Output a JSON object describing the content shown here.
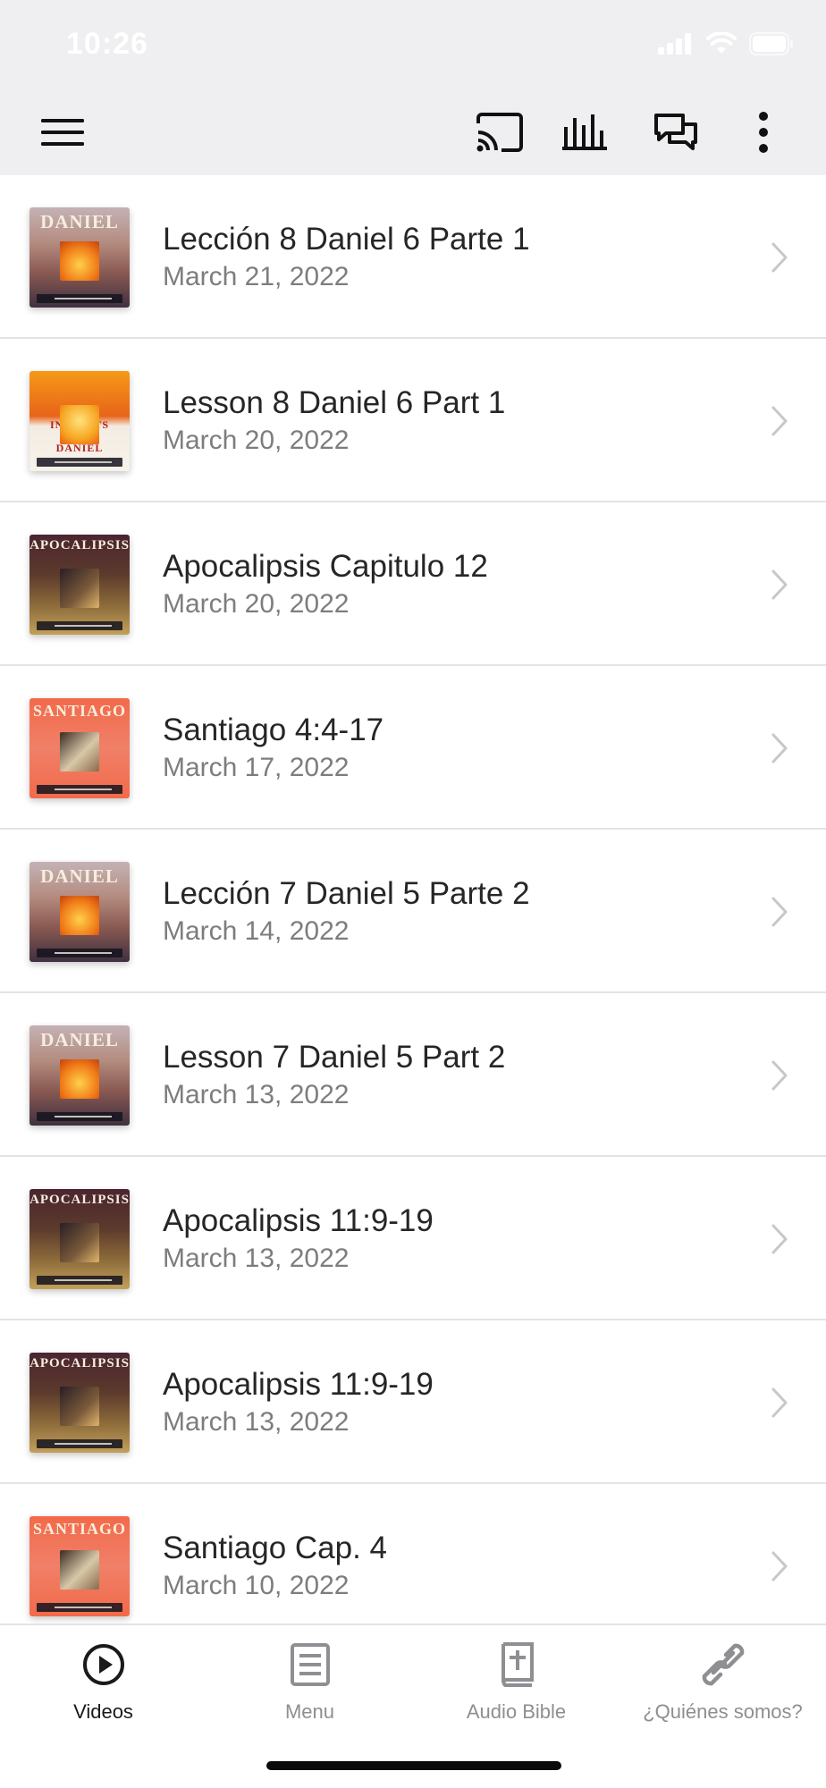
{
  "status_bar": {
    "time": "10:26",
    "icons": [
      "cellular-signal-icon",
      "wifi-icon",
      "battery-icon"
    ]
  },
  "app_bar": {
    "icons": [
      "hamburger-menu-icon",
      "cast-icon",
      "audio-bars-icon",
      "chat-icon",
      "more-vertical-icon"
    ]
  },
  "colors": {
    "bar_background": "#efeff1",
    "text_primary": "#262626",
    "text_secondary": "#7d7d80",
    "tab_active": "#1a1a1a",
    "tab_inactive": "#8e8e93",
    "divider": "#e3e3e6"
  },
  "videos": [
    {
      "title": "Lección 8 Daniel 6 Parte 1",
      "date": "March 21, 2022",
      "thumbnail": "daniel-series-thumbnail",
      "thumb_word": "DANIEL"
    },
    {
      "title": "Lesson 8 Daniel 6 Part 1",
      "date": "March 20, 2022",
      "thumbnail": "insights-book-of-daniel-thumbnail",
      "thumb_word": "INSIGHTS BOOK DANIEL"
    },
    {
      "title": "Apocalipsis Capitulo 12",
      "date": "March 20, 2022",
      "thumbnail": "apocalipsis-series-thumbnail",
      "thumb_word": "APOCALIPSIS"
    },
    {
      "title": "Santiago 4:4-17",
      "date": "March 17, 2022",
      "thumbnail": "santiago-series-thumbnail",
      "thumb_word": "SANTIAGO"
    },
    {
      "title": "Lección 7 Daniel 5 Parte 2",
      "date": "March 14, 2022",
      "thumbnail": "daniel-series-thumbnail",
      "thumb_word": "DANIEL"
    },
    {
      "title": "Lesson 7 Daniel 5 Part 2",
      "date": "March 13, 2022",
      "thumbnail": "daniel-series-thumbnail",
      "thumb_word": "DANIEL"
    },
    {
      "title": "Apocalipsis 11:9-19",
      "date": "March 13, 2022",
      "thumbnail": "apocalipsis-series-thumbnail",
      "thumb_word": "APOCALIPSIS"
    },
    {
      "title": "Apocalipsis 11:9-19",
      "date": "March 13, 2022",
      "thumbnail": "apocalipsis-series-thumbnail",
      "thumb_word": "APOCALIPSIS"
    },
    {
      "title": "Santiago Cap. 4",
      "date": "March 10, 2022",
      "thumbnail": "santiago-series-thumbnail",
      "thumb_word": "SANTIAGO"
    }
  ],
  "tabs": [
    {
      "label": "Videos",
      "icon": "play-circle-icon",
      "active": true
    },
    {
      "label": "Menu",
      "icon": "menu-document-icon",
      "active": false
    },
    {
      "label": "Audio Bible",
      "icon": "bible-icon",
      "active": false
    },
    {
      "label": "¿Quiénes somos?",
      "icon": "link-icon",
      "active": false
    }
  ]
}
